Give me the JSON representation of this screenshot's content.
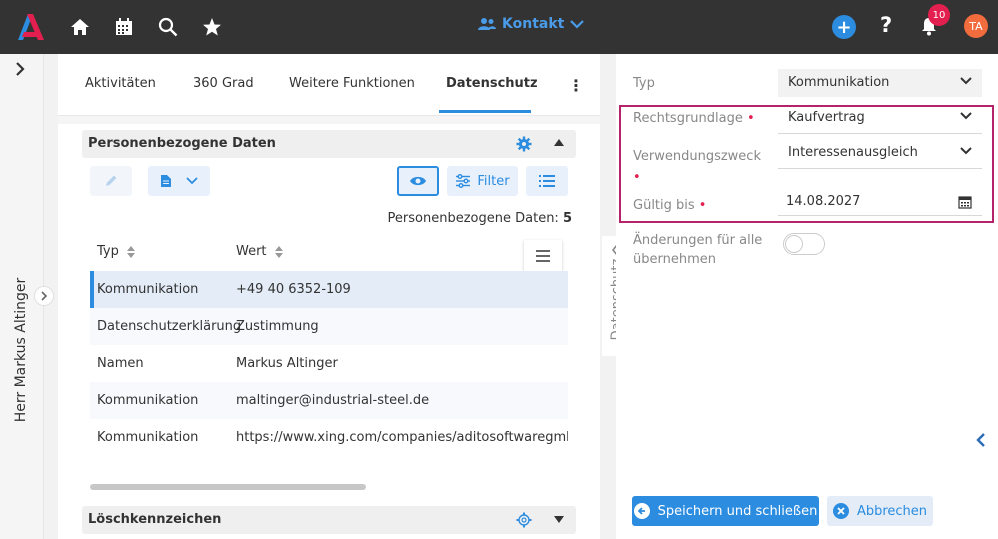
{
  "topbar": {
    "context_label": "Kontakt",
    "notification_count": "10",
    "avatar_initials": "TA",
    "help_label": "?"
  },
  "sidebar": {
    "contact_name": "Herr Markus Altinger"
  },
  "tabs": [
    {
      "label": "Aktivitäten"
    },
    {
      "label": "360 Grad"
    },
    {
      "label": "Weitere Funktionen"
    },
    {
      "label": "Datenschutz"
    }
  ],
  "personal_data": {
    "section_title": "Personenbezogene Daten",
    "filter_label": "Filter",
    "count_label": "Personenbezogene Daten:",
    "count_value": "5",
    "columns": [
      "Typ",
      "Wert"
    ],
    "rows": [
      {
        "typ": "Kommunikation",
        "wert": "+49 40 6352-109"
      },
      {
        "typ": "Datenschutzerklärung",
        "wert": "Zustimmung"
      },
      {
        "typ": "Namen",
        "wert": "Markus Altinger"
      },
      {
        "typ": "Kommunikation",
        "wert": "maltinger@industrial-steel.de"
      },
      {
        "typ": "Kommunikation",
        "wert": "https://www.xing.com/companies/aditosoftwaregmbh"
      }
    ]
  },
  "deletion": {
    "section_title": "Löschkennzeichen"
  },
  "side_panel": {
    "vertical_label": "Datenschutz",
    "typ_label": "Typ",
    "typ_value": "Kommunikation",
    "rechtsgrundlage_label": "Rechtsgrundlage",
    "rechtsgrundlage_value": "Kaufvertrag",
    "verwendungszweck_label": "Verwendungszweck",
    "verwendungszweck_value": "Interessenausgleich",
    "gueltig_label": "Gültig bis",
    "gueltig_value": "14.08.2027",
    "aenderungen_label_1": "Änderungen für alle",
    "aenderungen_label_2": "übernehmen",
    "required_marker": "•",
    "save_label": "Speichern und schließen",
    "cancel_label": "Abbrechen"
  },
  "colors": {
    "accent": "#2b8ce0",
    "topbar": "#333333",
    "required": "#e21f4e",
    "highlight_box": "#b5236b"
  }
}
